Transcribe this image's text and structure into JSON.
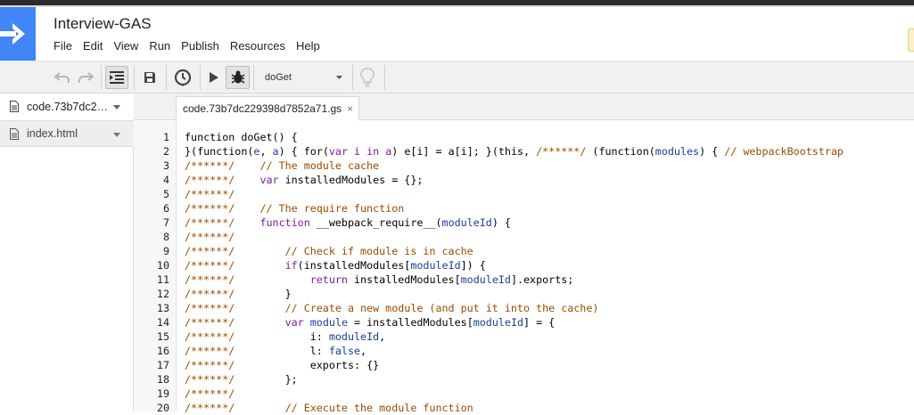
{
  "app": {
    "title": "Interview-GAS",
    "logo_icon": "arrow-right-icon",
    "brand_color": "#4285f4"
  },
  "menu": [
    "File",
    "Edit",
    "View",
    "Run",
    "Publish",
    "Resources",
    "Help"
  ],
  "toolbar": {
    "function_select": "doGet",
    "icons": [
      "undo-icon",
      "redo-icon",
      "indent-icon",
      "save-icon",
      "triggers-clock-icon",
      "run-play-icon",
      "debug-bug-icon",
      "lightbulb-icon"
    ]
  },
  "files": [
    {
      "name": "code.73b7dc229398d7852a71.gs",
      "active": true
    },
    {
      "name": "index.html",
      "active": false
    }
  ],
  "editor": {
    "tab_label": "code.73b7dc229398d7852a71.gs",
    "tab_close": "×",
    "lines": [
      {
        "n": "1",
        "tokens": [
          {
            "t": "function doGet() {",
            "c": "plain"
          }
        ]
      },
      {
        "n": "2",
        "tokens": [
          {
            "t": "}(function(",
            "c": "plain"
          },
          {
            "t": "e",
            "c": "vr"
          },
          {
            "t": ", ",
            "c": "plain"
          },
          {
            "t": "a",
            "c": "vr"
          },
          {
            "t": ") { for(",
            "c": "plain"
          },
          {
            "t": "var i in a",
            "c": "kw"
          },
          {
            "t": ") e[i] = a[i]; }(this, ",
            "c": "plain"
          },
          {
            "t": "/******/",
            "c": "cm"
          },
          {
            "t": " (function(",
            "c": "plain"
          },
          {
            "t": "modules",
            "c": "vr"
          },
          {
            "t": ") { ",
            "c": "plain"
          },
          {
            "t": "// webpackBootstrap",
            "c": "cm"
          }
        ]
      },
      {
        "n": "3",
        "tokens": [
          {
            "t": "/******/    // The module cache",
            "c": "cm"
          }
        ]
      },
      {
        "n": "4",
        "tokens": [
          {
            "t": "/******/    ",
            "c": "cm"
          },
          {
            "t": "var",
            "c": "kw"
          },
          {
            "t": " installedModules = {};",
            "c": "plain"
          }
        ]
      },
      {
        "n": "5",
        "tokens": [
          {
            "t": "/******/",
            "c": "cm"
          }
        ]
      },
      {
        "n": "6",
        "tokens": [
          {
            "t": "/******/    // The require function",
            "c": "cm"
          }
        ]
      },
      {
        "n": "7",
        "tokens": [
          {
            "t": "/******/    ",
            "c": "cm"
          },
          {
            "t": "function",
            "c": "kw"
          },
          {
            "t": " __webpack_require__(",
            "c": "plain"
          },
          {
            "t": "moduleId",
            "c": "vr"
          },
          {
            "t": ") {",
            "c": "plain"
          }
        ]
      },
      {
        "n": "8",
        "tokens": [
          {
            "t": "/******/",
            "c": "cm"
          }
        ]
      },
      {
        "n": "9",
        "tokens": [
          {
            "t": "/******/        // Check if module is in cache",
            "c": "cm"
          }
        ]
      },
      {
        "n": "10",
        "tokens": [
          {
            "t": "/******/        ",
            "c": "cm"
          },
          {
            "t": "if",
            "c": "kw"
          },
          {
            "t": "(installedModules[",
            "c": "plain"
          },
          {
            "t": "moduleId",
            "c": "vr"
          },
          {
            "t": "]) {",
            "c": "plain"
          }
        ]
      },
      {
        "n": "11",
        "tokens": [
          {
            "t": "/******/            ",
            "c": "cm"
          },
          {
            "t": "return",
            "c": "kw"
          },
          {
            "t": " installedModules[",
            "c": "plain"
          },
          {
            "t": "moduleId",
            "c": "vr"
          },
          {
            "t": "].exports;",
            "c": "plain"
          }
        ]
      },
      {
        "n": "12",
        "tokens": [
          {
            "t": "/******/        ",
            "c": "cm"
          },
          {
            "t": "}",
            "c": "plain"
          }
        ]
      },
      {
        "n": "13",
        "tokens": [
          {
            "t": "/******/        // Create a new module (and put it into the cache)",
            "c": "cm"
          }
        ]
      },
      {
        "n": "14",
        "tokens": [
          {
            "t": "/******/        ",
            "c": "cm"
          },
          {
            "t": "var",
            "c": "kw"
          },
          {
            "t": " ",
            "c": "plain"
          },
          {
            "t": "module",
            "c": "vr"
          },
          {
            "t": " = installedModules[",
            "c": "plain"
          },
          {
            "t": "moduleId",
            "c": "vr"
          },
          {
            "t": "] = {",
            "c": "plain"
          }
        ]
      },
      {
        "n": "15",
        "tokens": [
          {
            "t": "/******/            ",
            "c": "cm"
          },
          {
            "t": "i: ",
            "c": "plain"
          },
          {
            "t": "moduleId",
            "c": "vr"
          },
          {
            "t": ",",
            "c": "plain"
          }
        ]
      },
      {
        "n": "16",
        "tokens": [
          {
            "t": "/******/            ",
            "c": "cm"
          },
          {
            "t": "l: ",
            "c": "plain"
          },
          {
            "t": "false",
            "c": "vr"
          },
          {
            "t": ",",
            "c": "plain"
          }
        ]
      },
      {
        "n": "17",
        "tokens": [
          {
            "t": "/******/            ",
            "c": "cm"
          },
          {
            "t": "exports: {}",
            "c": "plain"
          }
        ]
      },
      {
        "n": "18",
        "tokens": [
          {
            "t": "/******/        ",
            "c": "cm"
          },
          {
            "t": "};",
            "c": "plain"
          }
        ]
      },
      {
        "n": "19",
        "tokens": [
          {
            "t": "/******/",
            "c": "cm"
          }
        ]
      },
      {
        "n": "20",
        "tokens": [
          {
            "t": "/******/        // Execute the module function",
            "c": "cm"
          }
        ]
      }
    ]
  }
}
